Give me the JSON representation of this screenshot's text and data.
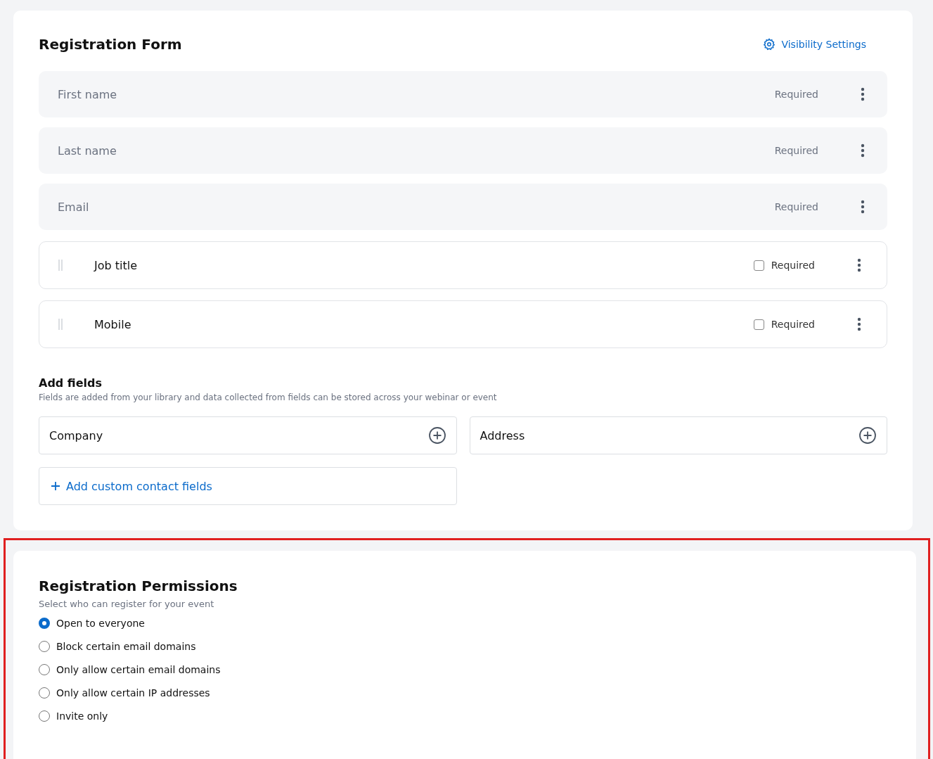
{
  "registration_form": {
    "title": "Registration Form",
    "visibility_link": "Visibility Settings",
    "fields": [
      {
        "kind": "fixed",
        "label": "First name",
        "required_label": "Required"
      },
      {
        "kind": "fixed",
        "label": "Last name",
        "required_label": "Required"
      },
      {
        "kind": "fixed",
        "label": "Email",
        "required_label": "Required"
      },
      {
        "kind": "custom",
        "label": "Job title",
        "required_label": "Required",
        "checked": false
      },
      {
        "kind": "custom",
        "label": "Mobile",
        "required_label": "Required",
        "checked": false
      }
    ],
    "add_fields": {
      "title": "Add fields",
      "description": "Fields are added from your library and data collected from fields can be stored across your webinar or event",
      "options": [
        "Company",
        "Address"
      ],
      "custom_link": "Add custom contact fields"
    }
  },
  "registration_permissions": {
    "highlighted": true,
    "title": "Registration Permissions",
    "subtitle": "Select who can register for your event",
    "options": [
      {
        "label": "Open to everyone",
        "selected": true
      },
      {
        "label": "Block certain email domains",
        "selected": false
      },
      {
        "label": "Only allow certain email domains",
        "selected": false
      },
      {
        "label": "Only allow certain IP addresses",
        "selected": false
      },
      {
        "label": "Invite only",
        "selected": false
      }
    ]
  }
}
